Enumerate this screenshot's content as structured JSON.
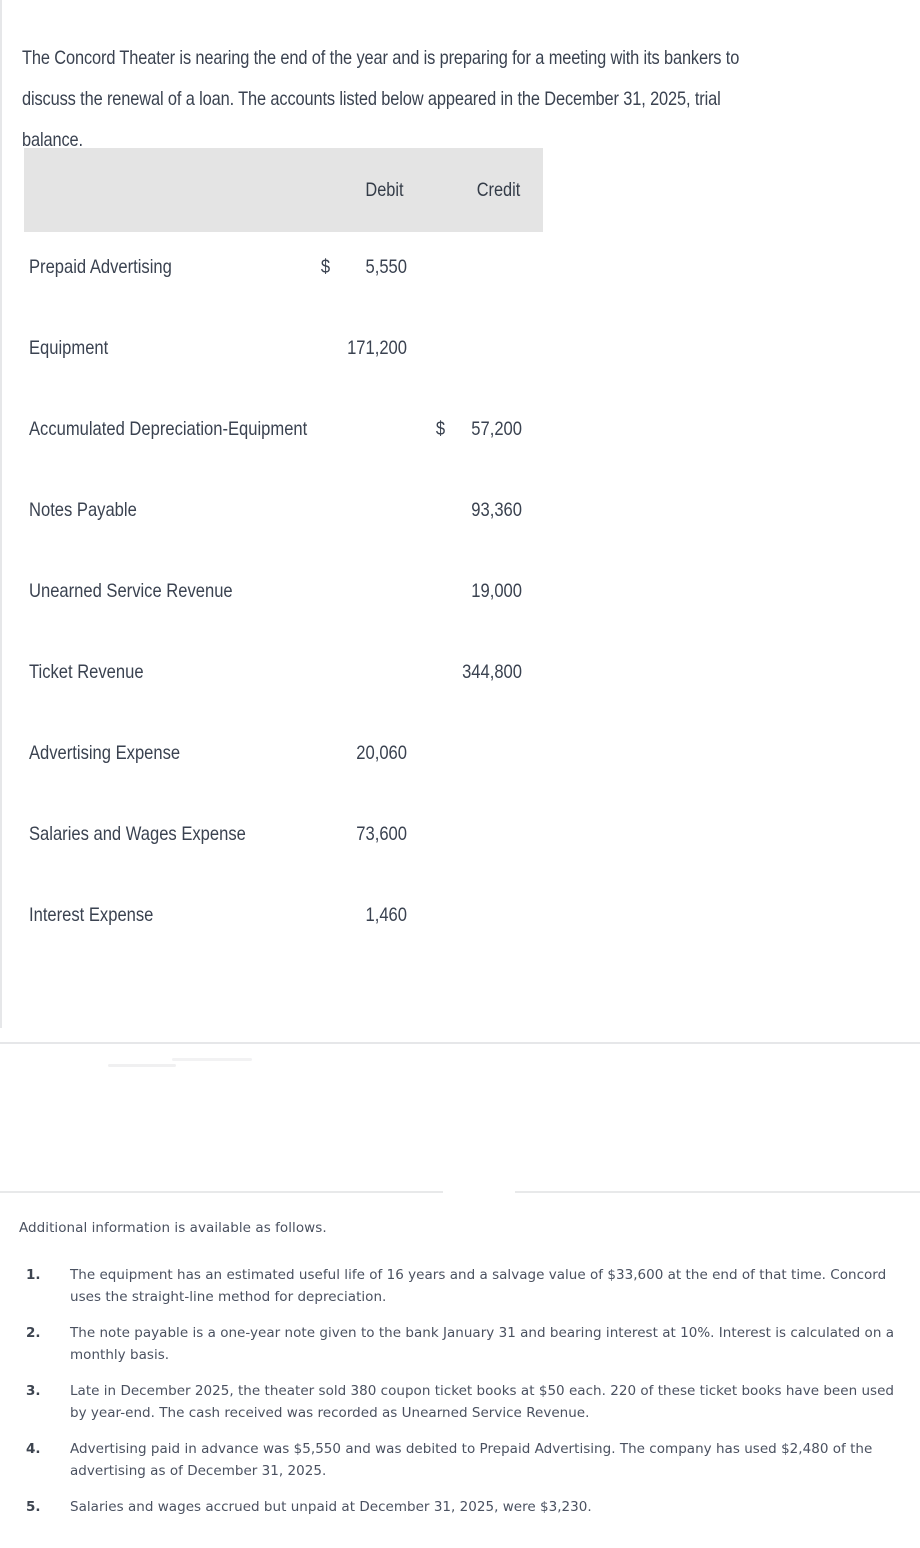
{
  "intro": {
    "paragraph": "The Concord Theater is nearing the end of the year and is preparing for a meeting with its bankers to discuss the renewal of a loan. The accounts listed below appeared in the December 31, 2025, trial balance."
  },
  "colors": {
    "header_background": "#e4e4e4",
    "text": "#3a4250",
    "divider": "#e6e7e9",
    "page_background": "#ffffff"
  },
  "trial_balance": {
    "columns": [
      "",
      "Debit",
      "Credit"
    ],
    "debit_header": "Debit",
    "credit_header": "Credit",
    "rows": [
      {
        "account": "Prepaid Advertising",
        "debit_symbol": "$",
        "debit": "5,550",
        "credit_symbol": "",
        "credit": ""
      },
      {
        "account": "Equipment",
        "debit_symbol": "",
        "debit": "171,200",
        "credit_symbol": "",
        "credit": ""
      },
      {
        "account": "Accumulated Depreciation-Equipment",
        "debit_symbol": "",
        "debit": "",
        "credit_symbol": "$",
        "credit": "57,200"
      },
      {
        "account": "Notes Payable",
        "debit_symbol": "",
        "debit": "",
        "credit_symbol": "",
        "credit": "93,360"
      },
      {
        "account": "Unearned Service Revenue",
        "debit_symbol": "",
        "debit": "",
        "credit_symbol": "",
        "credit": "19,000"
      },
      {
        "account": "Ticket Revenue",
        "debit_symbol": "",
        "debit": "",
        "credit_symbol": "",
        "credit": "344,800"
      },
      {
        "account": "Advertising Expense",
        "debit_symbol": "",
        "debit": "20,060",
        "credit_symbol": "",
        "credit": ""
      },
      {
        "account": "Salaries and Wages Expense",
        "debit_symbol": "",
        "debit": "73,600",
        "credit_symbol": "",
        "credit": ""
      },
      {
        "account": "Interest Expense",
        "debit_symbol": "",
        "debit": "1,460",
        "credit_symbol": "",
        "credit": ""
      }
    ]
  },
  "additional_info": {
    "heading": "Additional information is available as follows.",
    "items": [
      {
        "number": "1.",
        "text": "The equipment has an estimated useful life of 16 years and a salvage value of $33,600 at the end of that time. Concord uses the straight-line method for depreciation."
      },
      {
        "number": "2.",
        "text": "The note payable is a one-year note given to the bank January 31 and bearing interest at 10%. Interest is calculated on a monthly basis."
      },
      {
        "number": "3.",
        "text": "Late in December 2025, the theater sold 380 coupon ticket books at $50 each. 220 of these ticket books have been used by year-end. The cash received was recorded as Unearned Service Revenue."
      },
      {
        "number": "4.",
        "text": "Advertising paid in advance was $5,550 and was debited to Prepaid Advertising. The company has used $2,480 of the advertising as of December 31, 2025."
      },
      {
        "number": "5.",
        "text": "Salaries and wages accrued but unpaid at December 31, 2025, were $3,230."
      }
    ]
  }
}
